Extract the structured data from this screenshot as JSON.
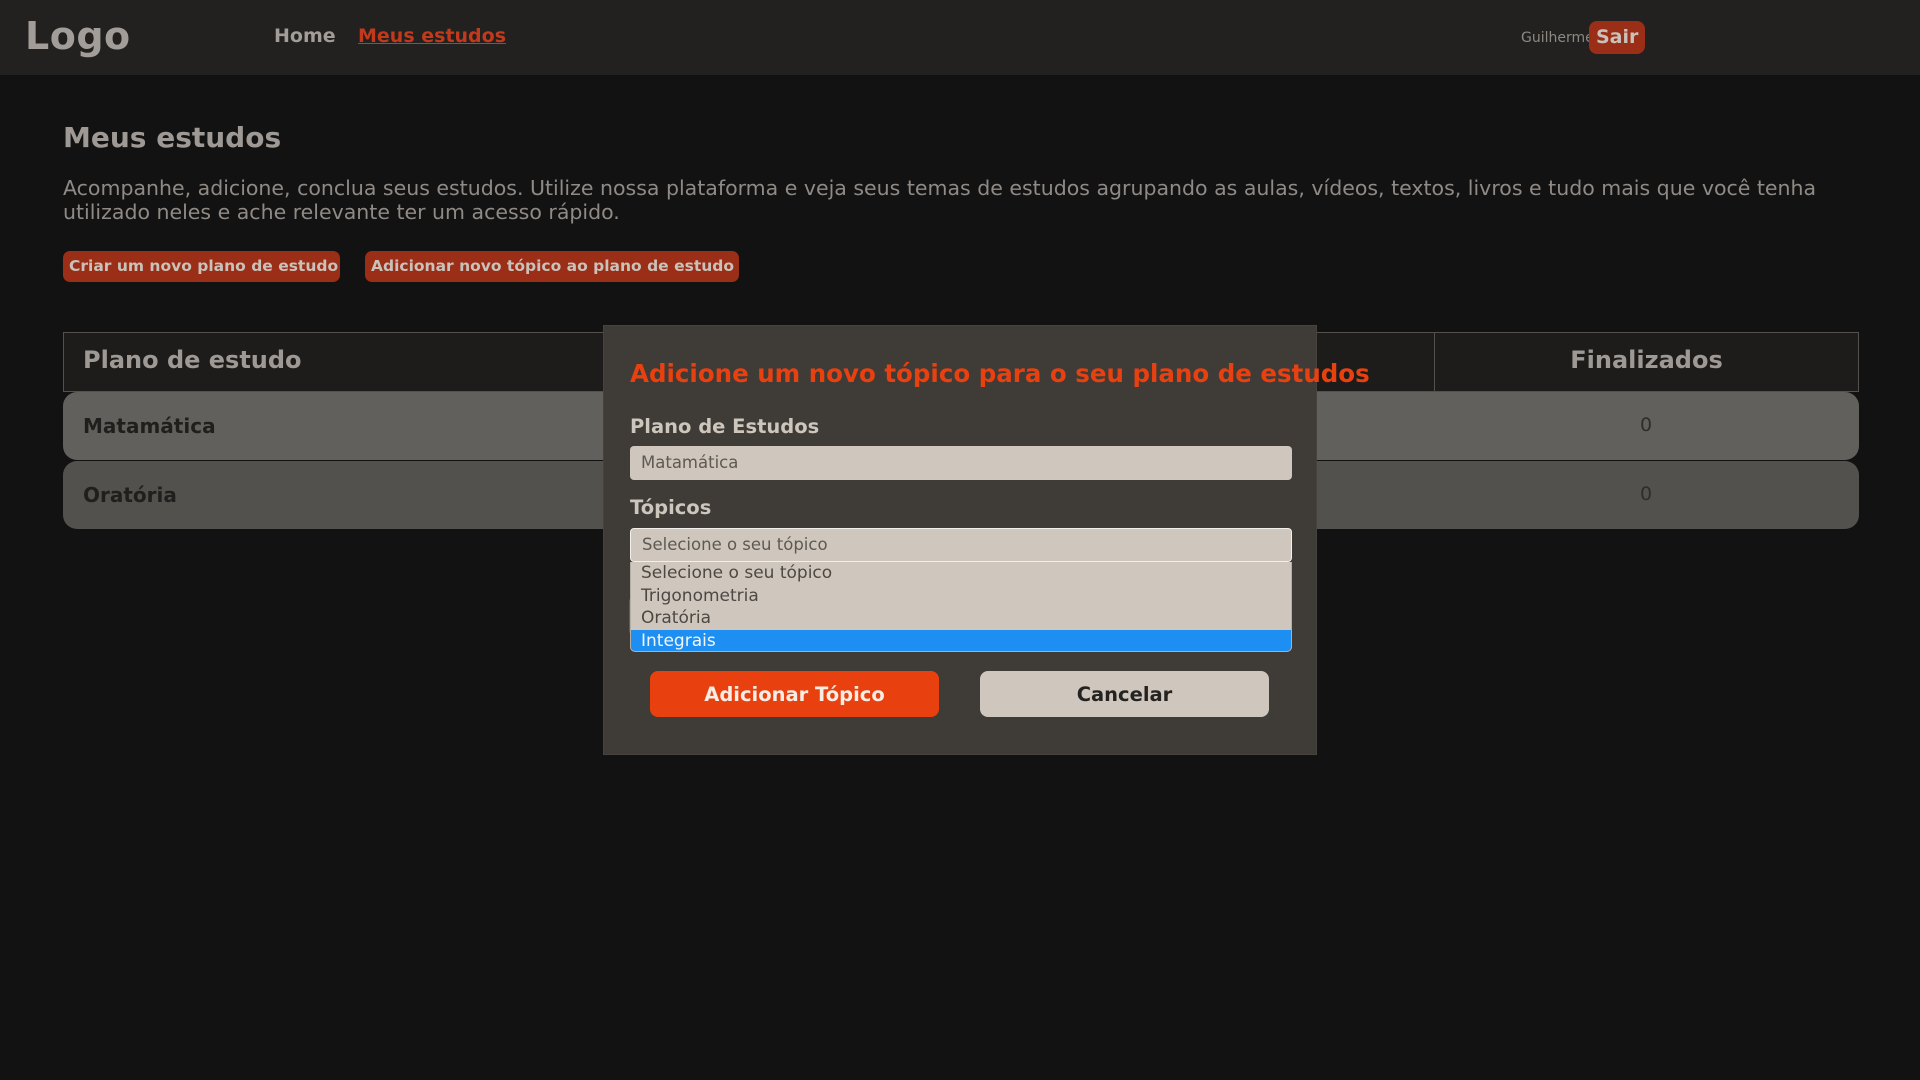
{
  "header": {
    "logo": "Logo",
    "nav": [
      {
        "label": "Home"
      },
      {
        "label": "Meus estudos"
      }
    ],
    "user": "Guilherme",
    "logout_label": "Sair"
  },
  "page": {
    "title": "Meus estudos",
    "intro": "Acompanhe, adicione, conclua seus estudos. Utilize nossa plataforma e veja seus temas de estudos agrupando as aulas, vídeos, textos, livros e tudo mais que você tenha utilizado neles e ache relevante ter um acesso rápido.",
    "create_plan_label": "Criar um novo plano de estudo",
    "add_topic_label": "Adicionar novo tópico ao plano de estudo"
  },
  "table": {
    "headers": {
      "plan": "Plano de estudo",
      "finished": "Finalizados"
    },
    "rows": [
      {
        "name": "Matamática",
        "finished": "0"
      },
      {
        "name": "Oratória",
        "finished": "0"
      }
    ]
  },
  "modal": {
    "title": "Adicione um novo tópico para o seu plano de estudos",
    "plan_label": "Plano de Estudos",
    "plan_value": "Matamática",
    "topics_label": "Tópicos",
    "topics_value": "Selecione o seu tópico",
    "options": [
      "Selecione o seu tópico",
      "Trigonometria",
      "Oratória",
      "Integrais"
    ],
    "highlighted_option": "Integrais",
    "add_label": "Adicionar Tópico",
    "cancel_label": "Cancelar"
  },
  "colors": {
    "accent": "#e9400f",
    "highlight": "#1e8ff2",
    "background": "#131212"
  }
}
